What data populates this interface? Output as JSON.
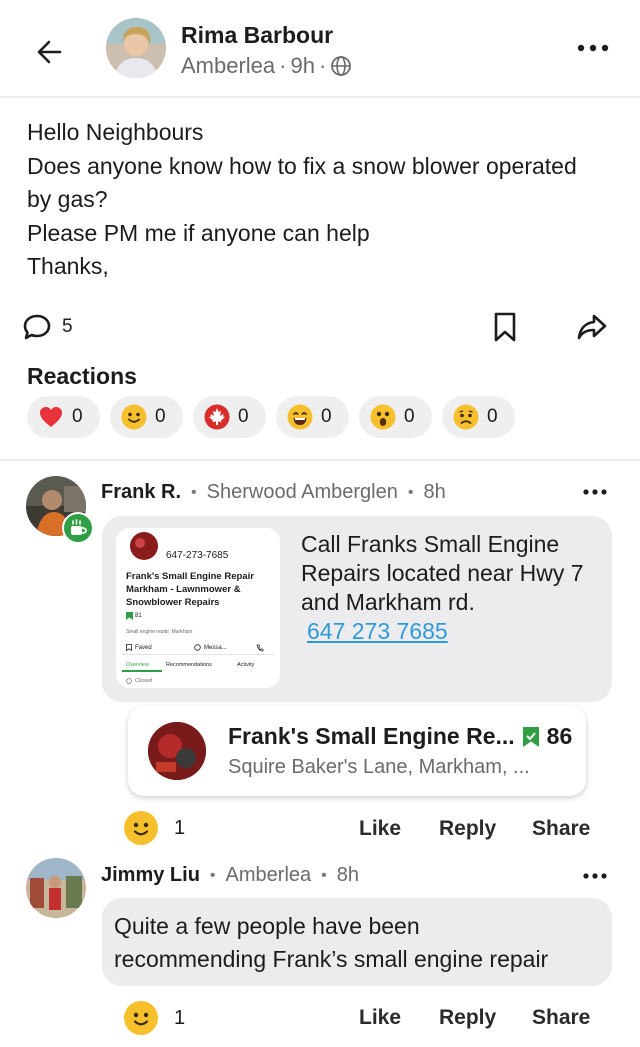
{
  "header": {
    "author_name": "Rima Barbour",
    "neighbourhood": "Amberlea",
    "time": "9h"
  },
  "post": {
    "lines": [
      "Hello Neighbours",
      "Does anyone know how to fix a snow blower operated",
      "by gas?",
      "Please PM me if anyone can help",
      "Thanks,"
    ],
    "comment_count": "5"
  },
  "reactions": {
    "title": "Reactions",
    "items": [
      {
        "icon": "heart-icon",
        "count": "0"
      },
      {
        "icon": "smile-icon",
        "count": "0"
      },
      {
        "icon": "maple-leaf-icon",
        "count": "0"
      },
      {
        "icon": "laugh-icon",
        "count": "0"
      },
      {
        "icon": "wow-icon",
        "count": "0"
      },
      {
        "icon": "sad-icon",
        "count": "0"
      }
    ]
  },
  "comments": [
    {
      "name": "Frank R.",
      "neighbourhood": "Sherwood Amberglen",
      "time": "8h",
      "text_lines": [
        "Call Franks Small Engine",
        "Repairs located near Hwy 7",
        "and Markham rd."
      ],
      "phone": "647 273 7685",
      "thumbnail": {
        "phone": "647-273-7685",
        "title_lines": [
          "Frank's Small Engine Repair",
          "Markham - Lawnmower &",
          "Snowblower Repairs"
        ],
        "faves": "81",
        "category": "Small engine repair, Markham",
        "btn_faved": "Faved",
        "btn_message": "Messa...",
        "tabs": [
          "Overview",
          "Recommendations",
          "Activity"
        ],
        "status": "Closed"
      },
      "business": {
        "name": "Frank's Small Engine Re...",
        "faves": "86",
        "address": "Squire Baker's Lane, Markham, ..."
      },
      "reaction_count": "1",
      "actions": {
        "like": "Like",
        "reply": "Reply",
        "share": "Share"
      }
    },
    {
      "name": "Jimmy Liu",
      "neighbourhood": "Amberlea",
      "time": "8h",
      "text_lines": [
        "Quite a few people have been",
        "recommending Frank’s small engine repair"
      ],
      "reaction_count": "1",
      "actions": {
        "like": "Like",
        "reply": "Reply",
        "share": "Share"
      }
    }
  ]
}
